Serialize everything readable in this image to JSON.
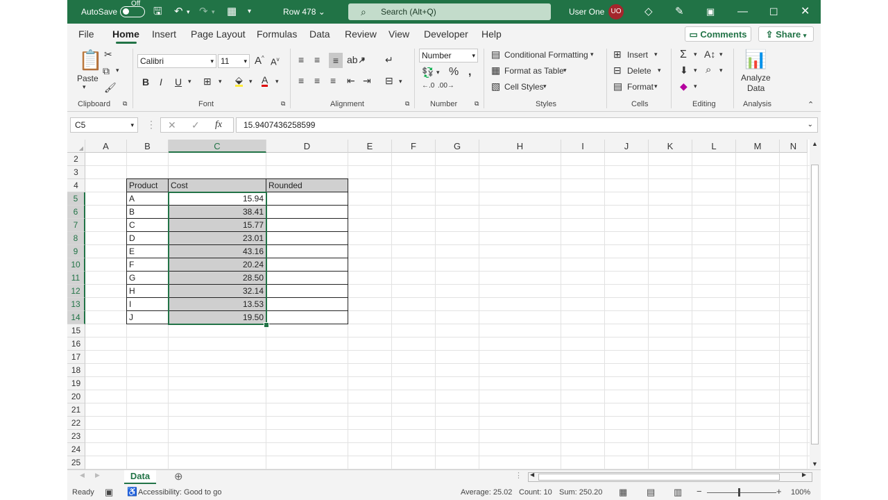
{
  "titlebar": {
    "autosave_label": "AutoSave",
    "autosave_state": "Off",
    "doc_title": "Row 478",
    "search_placeholder": "Search (Alt+Q)",
    "user_name": "User One",
    "user_initials": "UO"
  },
  "menu": {
    "items": [
      "File",
      "Home",
      "Insert",
      "Page Layout",
      "Formulas",
      "Data",
      "Review",
      "View",
      "Developer",
      "Help"
    ],
    "active": "Home",
    "comments_label": "Comments",
    "share_label": "Share"
  },
  "ribbon": {
    "clipboard": {
      "paste_label": "Paste",
      "group_label": "Clipboard"
    },
    "font": {
      "font_name": "Calibri",
      "font_size": "11",
      "group_label": "Font"
    },
    "alignment": {
      "group_label": "Alignment"
    },
    "number": {
      "format": "Number",
      "group_label": "Number"
    },
    "styles": {
      "conditional_formatting": "Conditional Formatting",
      "format_as_table": "Format as Table",
      "cell_styles": "Cell Styles",
      "group_label": "Styles"
    },
    "cells": {
      "insert": "Insert",
      "delete": "Delete",
      "format": "Format",
      "group_label": "Cells"
    },
    "editing": {
      "group_label": "Editing"
    },
    "analysis": {
      "analyze_line1": "Analyze",
      "analyze_line2": "Data",
      "group_label": "Analysis"
    }
  },
  "formula_bar": {
    "name_box": "C5",
    "formula": "15.9407436258599"
  },
  "grid": {
    "columns": [
      "A",
      "B",
      "C",
      "D",
      "E",
      "F",
      "G",
      "H",
      "I",
      "J",
      "K",
      "L",
      "M",
      "N"
    ],
    "rows": [
      "2",
      "3",
      "4",
      "5",
      "6",
      "7",
      "8",
      "9",
      "10",
      "11",
      "12",
      "13",
      "14",
      "15",
      "16",
      "17",
      "18",
      "19",
      "20",
      "21",
      "22",
      "23",
      "24",
      "25"
    ],
    "selected_column": "C",
    "table_headers": [
      "Product",
      "Cost",
      "Rounded"
    ],
    "table_rows": [
      {
        "product": "A",
        "cost": "15.94",
        "rounded": ""
      },
      {
        "product": "B",
        "cost": "38.41",
        "rounded": ""
      },
      {
        "product": "C",
        "cost": "15.77",
        "rounded": ""
      },
      {
        "product": "D",
        "cost": "23.01",
        "rounded": ""
      },
      {
        "product": "E",
        "cost": "43.16",
        "rounded": ""
      },
      {
        "product": "F",
        "cost": "20.24",
        "rounded": ""
      },
      {
        "product": "G",
        "cost": "28.50",
        "rounded": ""
      },
      {
        "product": "H",
        "cost": "32.14",
        "rounded": ""
      },
      {
        "product": "I",
        "cost": "13.53",
        "rounded": ""
      },
      {
        "product": "J",
        "cost": "19.50",
        "rounded": ""
      }
    ]
  },
  "sheet_tab": "Data",
  "status": {
    "ready": "Ready",
    "accessibility": "Accessibility: Good to go",
    "average": "Average: 25.02",
    "count": "Count: 10",
    "sum": "Sum: 250.20",
    "zoom": "100%"
  },
  "colors": {
    "accent": "#217346",
    "avatar": "#a4262c"
  }
}
